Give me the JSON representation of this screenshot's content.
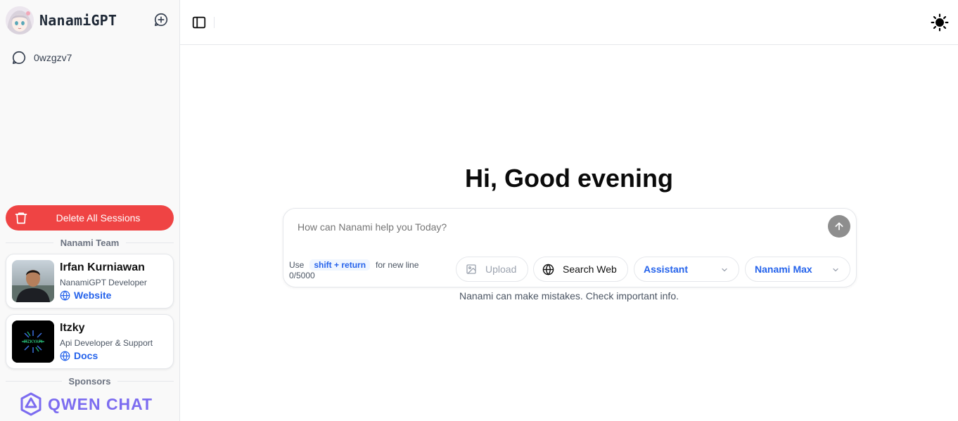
{
  "app": {
    "name": "NanamiGPT"
  },
  "sidebar": {
    "sessions": [
      {
        "label": "0wzgzv7"
      }
    ],
    "delete_all_label": "Delete All Sessions",
    "team_title": "Nanami Team",
    "team": [
      {
        "name": "Irfan Kurniawan",
        "role": "NanamiGPT Developer",
        "link": "Website"
      },
      {
        "name": "Itzky",
        "role": "Api Developer & Support",
        "link": "Docs",
        "logo_text": "ITZKYAPI"
      }
    ],
    "sponsors_title": "Sponsors",
    "sponsor": {
      "name": "QWEN CHAT"
    }
  },
  "main": {
    "greeting": "Hi, Good evening",
    "composer": {
      "placeholder": "How can Nanami help you Today?",
      "hint_prefix": "Use",
      "hint_key": "shift + return",
      "hint_suffix": "for new line",
      "counter": "0/5000",
      "upload_label": "Upload",
      "search_label": "Search Web",
      "mode_selected": "Assistant",
      "model_selected": "Nanami Max"
    },
    "disclaimer": "Nanami can make mistakes. Check important info."
  },
  "icons": {
    "new_chat": "new-chat-icon",
    "chat": "chat-bubble-icon",
    "trash": "trash-icon",
    "globe": "globe-icon",
    "sidebar_toggle": "sidebar-toggle-icon",
    "theme": "sun-icon",
    "send": "arrow-up-icon",
    "image": "image-upload-icon",
    "chevron": "chevron-down-icon"
  },
  "colors": {
    "danger": "#ef4444",
    "accent": "#2563eb",
    "send": "#8e8e8e",
    "sponsor": "#7c6cf0"
  }
}
